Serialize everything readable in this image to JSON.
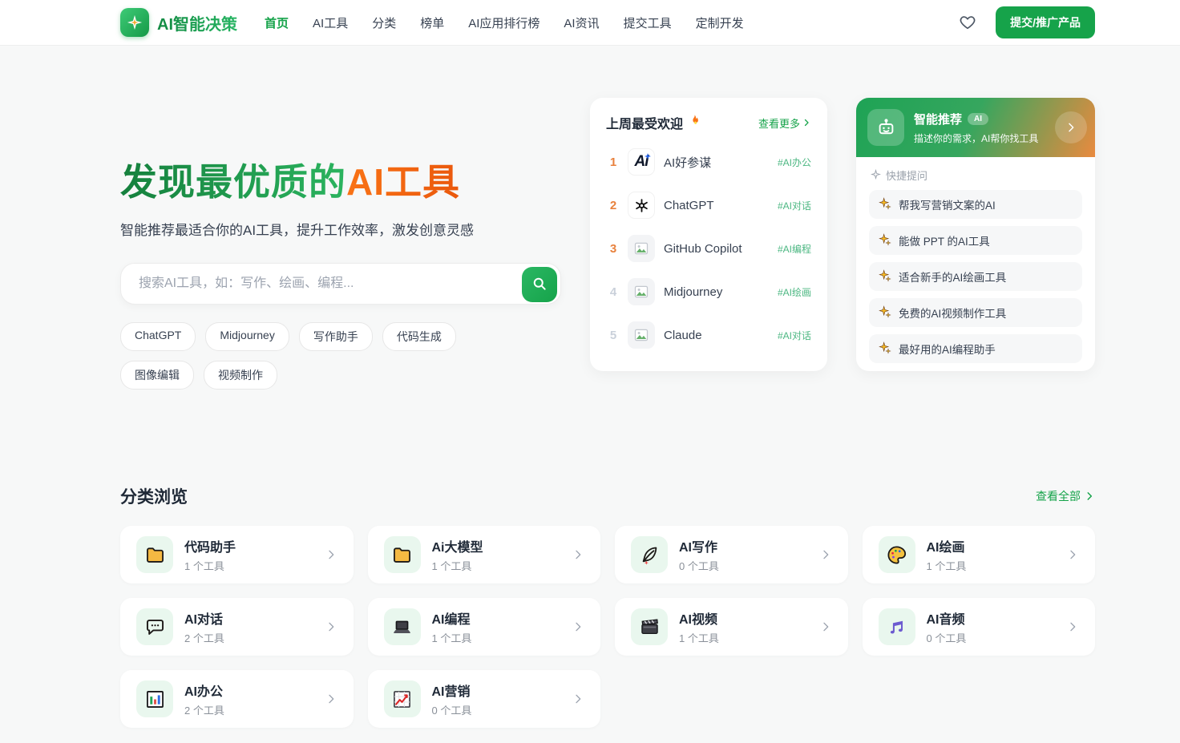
{
  "header": {
    "logo_text": "AI智能决策",
    "nav": [
      {
        "label": "首页",
        "active": true
      },
      {
        "label": "AI工具"
      },
      {
        "label": "分类"
      },
      {
        "label": "榜单"
      },
      {
        "label": "AI应用排行榜"
      },
      {
        "label": "AI资讯"
      },
      {
        "label": "提交工具"
      },
      {
        "label": "定制开发"
      }
    ],
    "submit_button": "提交/推广产品"
  },
  "hero": {
    "title_green": "发现最优质的",
    "title_orange": "AI工具",
    "subtitle": "智能推荐最适合你的AI工具，提升工作效率，激发创意灵感",
    "search_placeholder": "搜索AI工具，如：写作、绘画、编程...",
    "tags": [
      "ChatGPT",
      "Midjourney",
      "写作助手",
      "代码生成",
      "图像编辑",
      "视频制作"
    ]
  },
  "popular": {
    "title": "上周最受欢迎",
    "more_link": "查看更多",
    "items": [
      {
        "rank": "1",
        "name": "AI好参谋",
        "tag": "#AI办公",
        "logo": "ai-haocanmou-logo"
      },
      {
        "rank": "2",
        "name": "ChatGPT",
        "tag": "#AI对话",
        "logo": "openai-logo"
      },
      {
        "rank": "3",
        "name": "GitHub Copilot",
        "tag": "#AI编程",
        "logo": "image-placeholder"
      },
      {
        "rank": "4",
        "name": "Midjourney",
        "tag": "#AI绘画",
        "logo": "image-placeholder"
      },
      {
        "rank": "5",
        "name": "Claude",
        "tag": "#AI对话",
        "logo": "image-placeholder"
      }
    ]
  },
  "recommend": {
    "title": "智能推荐",
    "badge": "AI",
    "subtitle": "描述你的需求，AI帮你找工具",
    "quick_label": "快捷提问",
    "questions": [
      "帮我写营销文案的AI",
      "能做 PPT 的AI工具",
      "适合新手的AI绘画工具",
      "免费的AI视频制作工具",
      "最好用的AI编程助手"
    ]
  },
  "categories": {
    "title": "分类浏览",
    "view_all": "查看全部",
    "items": [
      {
        "name": "代码助手",
        "count": "1 个工具",
        "icon": "folder-icon"
      },
      {
        "name": "Ai大模型",
        "count": "1 个工具",
        "icon": "folder-icon"
      },
      {
        "name": "AI写作",
        "count": "0 个工具",
        "icon": "feather-pen-icon"
      },
      {
        "name": "AI绘画",
        "count": "1 个工具",
        "icon": "palette-icon"
      },
      {
        "name": "AI对话",
        "count": "2 个工具",
        "icon": "speech-bubble-icon"
      },
      {
        "name": "AI编程",
        "count": "1 个工具",
        "icon": "laptop-icon"
      },
      {
        "name": "AI视频",
        "count": "1 个工具",
        "icon": "clapperboard-icon"
      },
      {
        "name": "AI音频",
        "count": "0 个工具",
        "icon": "music-note-icon"
      },
      {
        "name": "AI办公",
        "count": "2 个工具",
        "icon": "bar-chart-icon"
      },
      {
        "name": "AI营销",
        "count": "0 个工具",
        "icon": "chart-up-icon"
      }
    ]
  },
  "colors": {
    "primary_green": "#16a34a",
    "accent_orange": "#f97316",
    "rank_orange": "#e8813d",
    "tag_green": "#4cb782",
    "page_bg": "#f7f8f8",
    "gradient_header": [
      "#1ea355",
      "#e98a3f"
    ]
  }
}
